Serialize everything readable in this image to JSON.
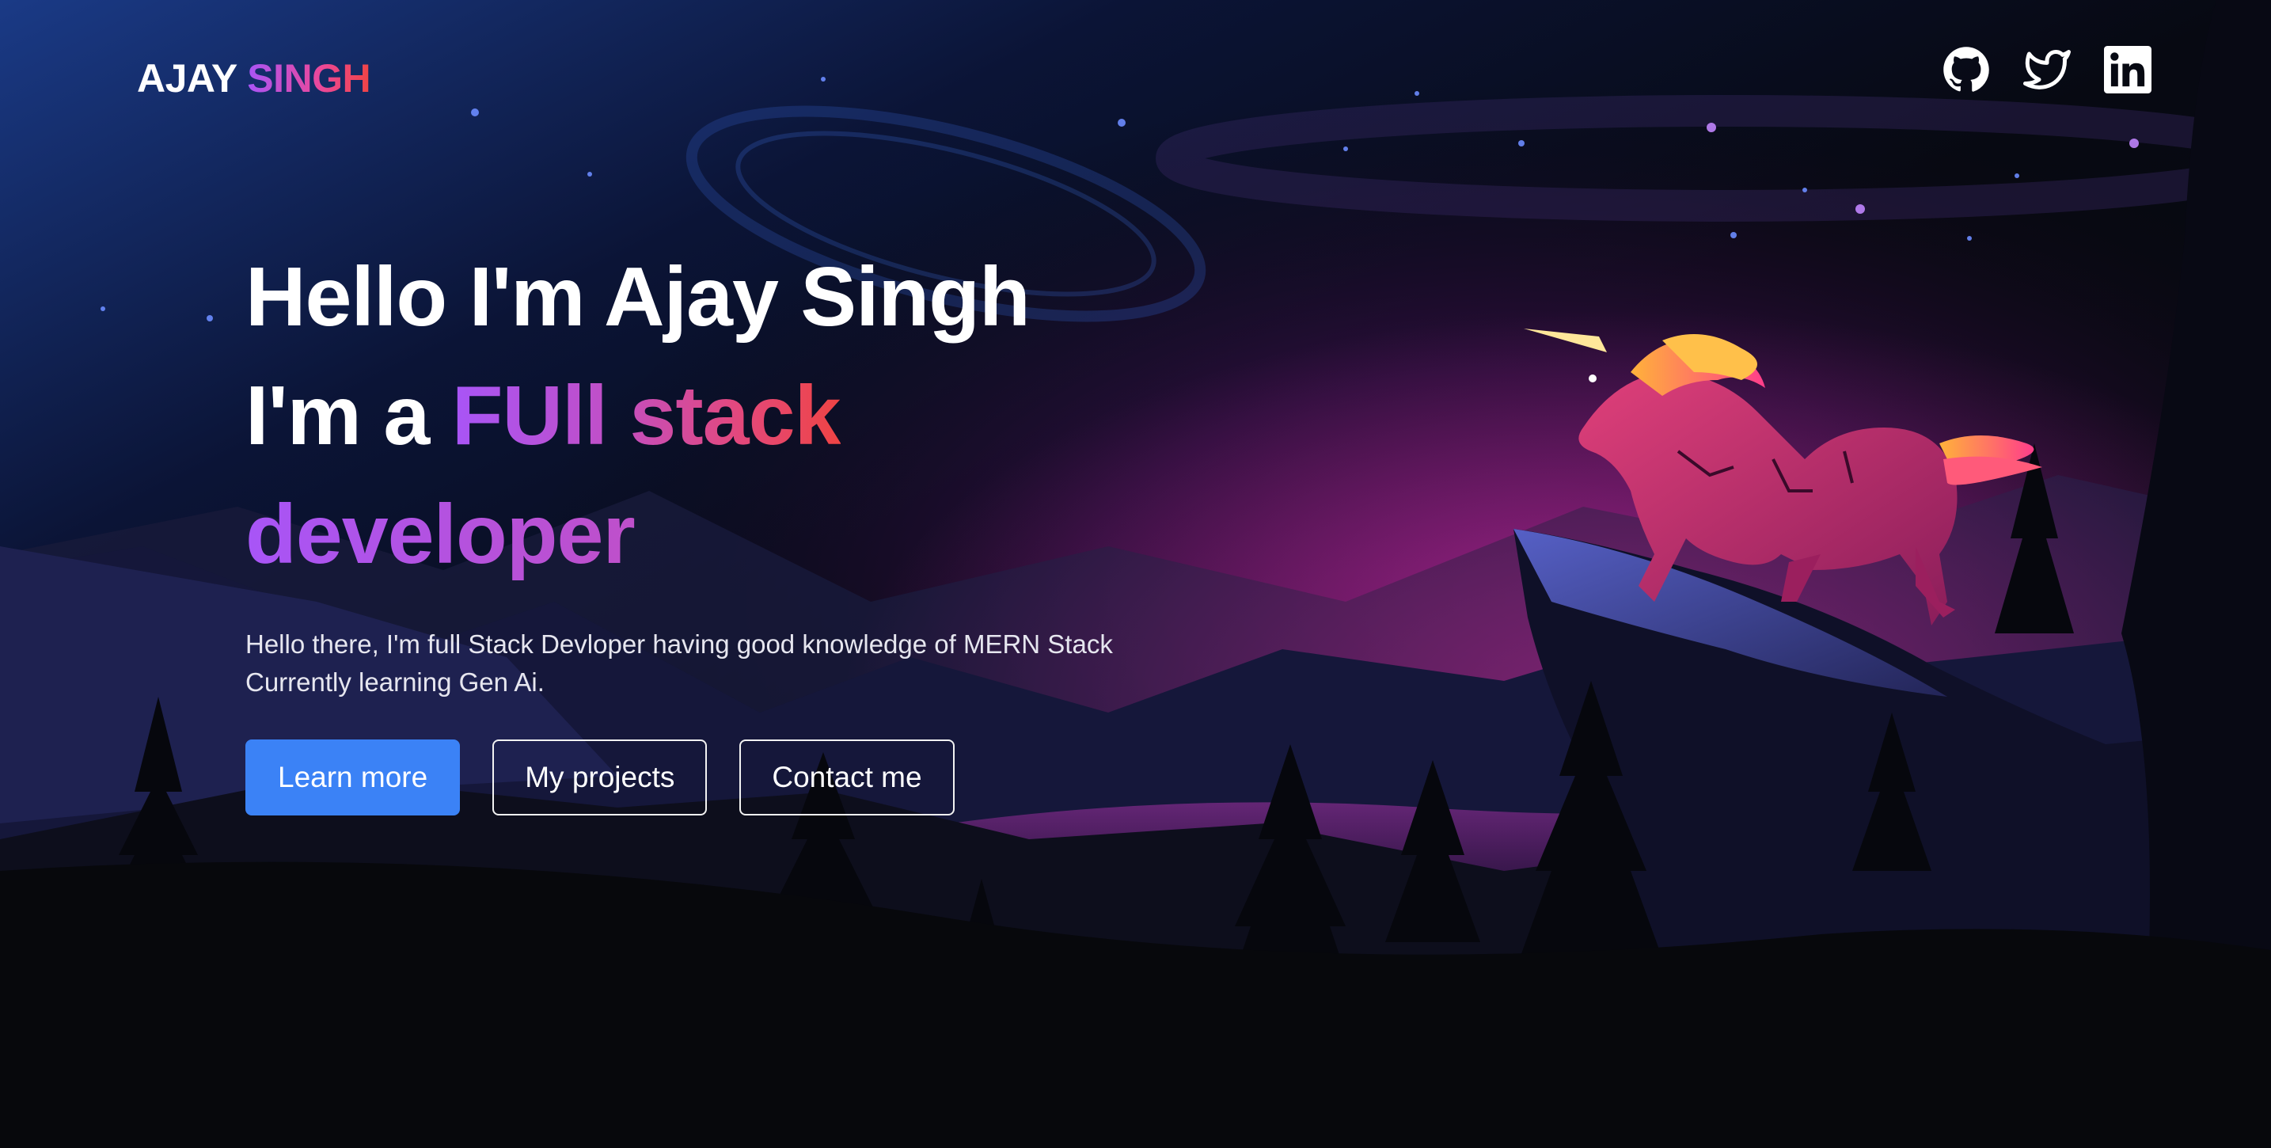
{
  "header": {
    "brand_first": "AJAY",
    "brand_second": "SINGH",
    "social": [
      {
        "name": "github",
        "icon": "github-icon"
      },
      {
        "name": "twitter",
        "icon": "twitter-icon"
      },
      {
        "name": "linkedin",
        "icon": "linkedin-icon"
      }
    ]
  },
  "hero": {
    "line1": "Hello I'm Ajay Singh",
    "line2_plain": "I'm a ",
    "line2_highlight": "FUll stack",
    "line3_highlight": "developer",
    "intro_line1": "Hello there, I'm full Stack Devloper having good knowledge of MERN Stack",
    "intro_line2": "Currently learning Gen Ai."
  },
  "buttons": {
    "learn_more": "Learn more",
    "projects": "My projects",
    "contact": "Contact me"
  },
  "colors": {
    "primary_button": "#3b82f6",
    "gradient_start": "#a855f7",
    "gradient_mid": "#ec4899",
    "gradient_end": "#ef4444",
    "background": "#07080c"
  }
}
